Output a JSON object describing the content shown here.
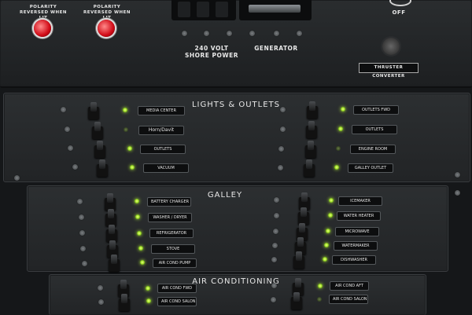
{
  "top": {
    "polarity_left": "POLARITY REVERSED WHEN LIT",
    "polarity_right": "POLARITY REVERSED WHEN LIT",
    "shore_power": "240 VOLT SHORE POWER",
    "generator": "GENERATOR",
    "off": "OFF",
    "thruster": "THRUSTER CONVERTER"
  },
  "lights": {
    "title": "LIGHTS & OUTLETS",
    "left": [
      "MEDIA CENTER",
      "Horn/Davit",
      "OUTLETS",
      "VACUUM"
    ],
    "right": [
      "OUTLETS FWD",
      "OUTLETS",
      "ENGINE ROOM",
      "GALLEY OUTLET"
    ]
  },
  "galley": {
    "title": "GALLEY",
    "left": [
      "BATTERY CHARGER",
      "WASHER / DRYER",
      "REFRIGERATOR",
      "STOVE",
      "AIR COND PUMP"
    ],
    "right": [
      "ICEMAKER",
      "WATER HEATER",
      "MICROWAVE",
      "WATERMAKER",
      "DISHWASHER"
    ]
  },
  "aircon": {
    "title": "AIR CONDITIONING",
    "left": [
      "AIR COND FWD",
      "AIR COND SALON"
    ],
    "right": [
      "AIR COND AFT",
      "AIR COND SALON"
    ]
  }
}
